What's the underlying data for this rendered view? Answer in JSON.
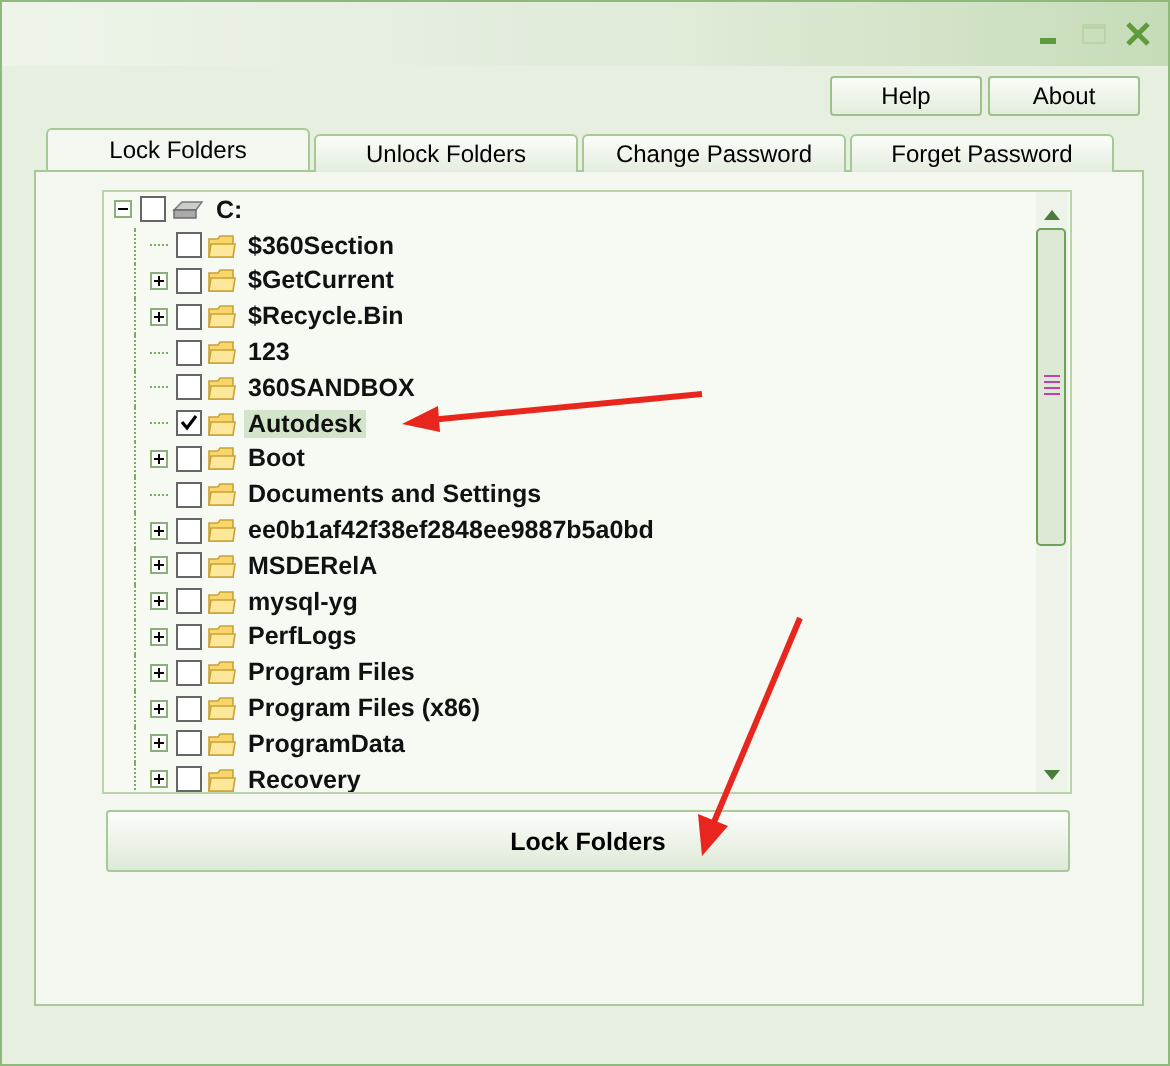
{
  "toolbar": {
    "buttons": [
      "Help",
      "About"
    ]
  },
  "tabs": [
    {
      "label": "Lock Folders",
      "selected": true
    },
    {
      "label": "Unlock Folders",
      "selected": false
    },
    {
      "label": "Change Password",
      "selected": false
    },
    {
      "label": "Forget Password",
      "selected": false
    }
  ],
  "tree": {
    "label": "C:",
    "expanded": true,
    "checked": false,
    "children": [
      {
        "label": "$360Section",
        "has_children": false,
        "checked": false,
        "selected": false
      },
      {
        "label": "$GetCurrent",
        "has_children": true,
        "checked": false,
        "selected": false
      },
      {
        "label": "$Recycle.Bin",
        "has_children": true,
        "checked": false,
        "selected": false
      },
      {
        "label": "123",
        "has_children": false,
        "checked": false,
        "selected": false
      },
      {
        "label": "360SANDBOX",
        "has_children": false,
        "checked": false,
        "selected": false
      },
      {
        "label": "Autodesk",
        "has_children": false,
        "checked": true,
        "selected": true
      },
      {
        "label": "Boot",
        "has_children": true,
        "checked": false,
        "selected": false
      },
      {
        "label": "Documents and Settings",
        "has_children": false,
        "checked": false,
        "selected": false
      },
      {
        "label": "ee0b1af42f38ef2848ee9887b5a0bd",
        "has_children": true,
        "checked": false,
        "selected": false
      },
      {
        "label": "MSDERelA",
        "has_children": true,
        "checked": false,
        "selected": false
      },
      {
        "label": "mysql-yg",
        "has_children": true,
        "checked": false,
        "selected": false
      },
      {
        "label": "PerfLogs",
        "has_children": true,
        "checked": false,
        "selected": false
      },
      {
        "label": "Program Files",
        "has_children": true,
        "checked": false,
        "selected": false
      },
      {
        "label": "Program Files (x86)",
        "has_children": true,
        "checked": false,
        "selected": false
      },
      {
        "label": "ProgramData",
        "has_children": true,
        "checked": false,
        "selected": false
      },
      {
        "label": "Recovery",
        "has_children": true,
        "checked": false,
        "selected": false
      }
    ]
  },
  "action_button": "Lock Folders"
}
